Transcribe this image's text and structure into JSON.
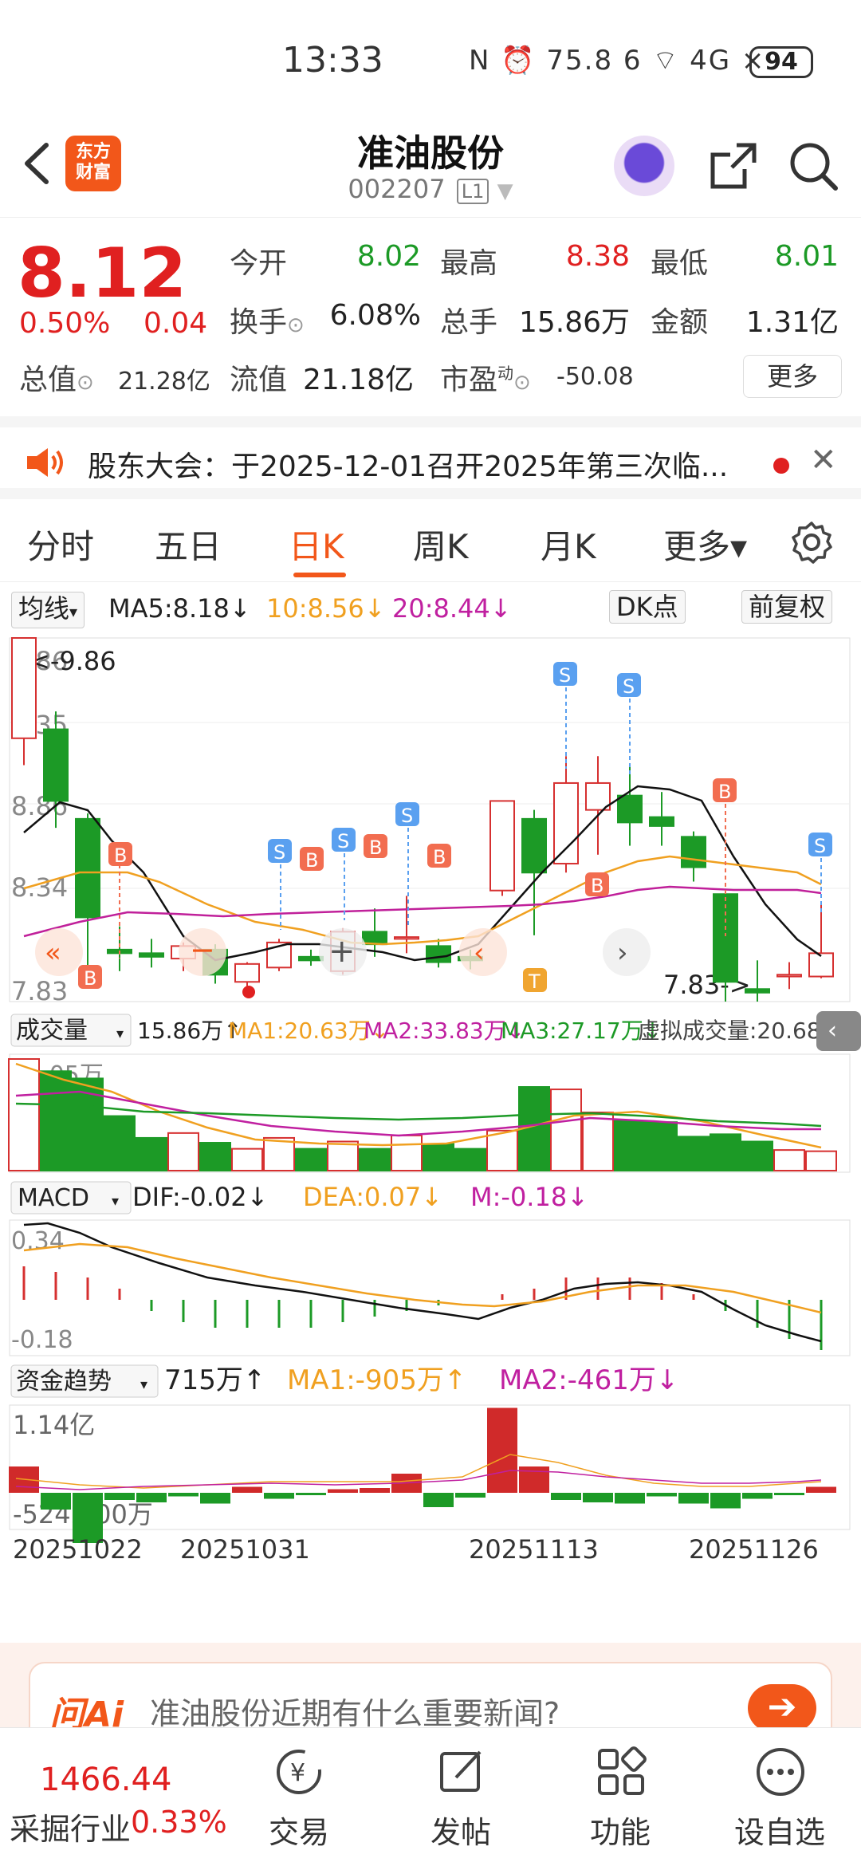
{
  "status": {
    "time": "13:33",
    "speed": "75.8 K/s",
    "battery": "94",
    "icons": "N ⏰ 75.8 6 ⌔ 4G ×"
  },
  "header": {
    "brand": "东方财富",
    "brand_line1": "东方",
    "brand_line2": "财富",
    "stock_name": "准油股份",
    "stock_code": "002207",
    "level": "L1"
  },
  "quote": {
    "price": "8.12",
    "change_pct": "0.50%",
    "change_amt": "0.04",
    "open_label": "今开",
    "open": "8.02",
    "high_label": "最高",
    "high": "8.38",
    "low_label": "最低",
    "low": "8.01",
    "turnover_label": "换手",
    "turnover": "6.08%",
    "volume_label": "总手",
    "volume": "15.86万",
    "amount_label": "金额",
    "amount": "1.31亿",
    "mktcap_label": "总值",
    "mktcap": "21.28亿",
    "float_label": "流值",
    "float": "21.18亿",
    "pe_label": "市盈",
    "pe_sup": "动",
    "pe": "-50.08",
    "more": "更多"
  },
  "notice": {
    "text": "股东大会：于2025-12-01召开2025年第三次临...",
    "close": "✕"
  },
  "tabs": [
    {
      "label": "分时"
    },
    {
      "label": "五日"
    },
    {
      "label": "日K"
    },
    {
      "label": "周K"
    },
    {
      "label": "月K"
    },
    {
      "label": "更多▾"
    }
  ],
  "kline_header": {
    "ma_select": "均线",
    "ma5": "MA5:8.18↓",
    "ma10": "10:8.56↓",
    "ma20": "20:8.44↓",
    "dk": "DK点",
    "adjust": "前复权"
  },
  "kline_axis": {
    "top": "9.86",
    "mid1": "9.35",
    "mid2": "8.86",
    "mid3": "8.34",
    "bottom": "7.83",
    "max_mark": "<-9.86",
    "min_mark": "7.83->"
  },
  "volume_header": {
    "select": "成交量",
    "vol": "15.86万↑",
    "ma1": "MA1:20.63万↓",
    "ma2": "MA2:33.83万↓",
    "ma3": "MA3:27.17万↓",
    "virtual": "虚拟成交量:20.68万",
    "axis_top": "92.05万"
  },
  "macd_header": {
    "select": "MACD",
    "dif": "DIF:-0.02↓",
    "dea": "DEA:0.07↓",
    "m": "M:-0.18↓",
    "axis_top": "0.34",
    "axis_bottom": "-0.18"
  },
  "fund_header": {
    "select": "资金趋势",
    "val": "715万↑",
    "ma1": "MA1:-905万↑",
    "ma2": "MA2:-461万↓",
    "axis_top": "1.14亿",
    "axis_bottom": "-5242.00万"
  },
  "dates": [
    "20251022",
    "20251031",
    "20251113",
    "20251126"
  ],
  "signals": {
    "b": "B",
    "s": "S",
    "t": "T"
  },
  "chart_data": {
    "type": "candlestick",
    "dates_shown": [
      "20251022",
      "20251031",
      "20251113",
      "20251126"
    ],
    "y_range": [
      7.83,
      9.86
    ],
    "candles": [
      {
        "o": 9.3,
        "c": 9.86,
        "h": 9.86,
        "l": 9.15
      },
      {
        "o": 9.35,
        "c": 8.95,
        "h": 9.45,
        "l": 8.8
      },
      {
        "o": 8.85,
        "c": 8.3,
        "h": 8.88,
        "l": 8.02
      },
      {
        "o": 8.12,
        "c": 8.1,
        "h": 8.25,
        "l": 8.0
      },
      {
        "o": 8.1,
        "c": 8.08,
        "h": 8.18,
        "l": 8.02
      },
      {
        "o": 8.07,
        "c": 8.14,
        "h": 8.16,
        "l": 8.0
      },
      {
        "o": 8.12,
        "c": 7.98,
        "h": 8.15,
        "l": 7.93
      },
      {
        "o": 7.94,
        "c": 8.04,
        "h": 8.05,
        "l": 7.9
      },
      {
        "o": 8.02,
        "c": 8.16,
        "h": 8.18,
        "l": 8.0
      },
      {
        "o": 8.08,
        "c": 8.06,
        "h": 8.12,
        "l": 8.03
      },
      {
        "o": 8.0,
        "c": 8.22,
        "h": 8.24,
        "l": 7.98
      },
      {
        "o": 8.22,
        "c": 8.15,
        "h": 8.35,
        "l": 8.08
      },
      {
        "o": 8.18,
        "c": 8.19,
        "h": 8.42,
        "l": 8.1
      },
      {
        "o": 8.14,
        "c": 8.05,
        "h": 8.18,
        "l": 8.02
      },
      {
        "o": 8.08,
        "c": 8.06,
        "h": 8.12,
        "l": 8.01
      },
      {
        "o": 8.45,
        "c": 8.95,
        "h": 8.95,
        "l": 8.42
      },
      {
        "o": 8.85,
        "c": 8.55,
        "h": 8.9,
        "l": 8.2
      },
      {
        "o": 8.6,
        "c": 9.05,
        "h": 9.2,
        "l": 8.55
      },
      {
        "o": 8.9,
        "c": 9.05,
        "h": 9.2,
        "l": 8.65
      },
      {
        "o": 8.98,
        "c": 8.83,
        "h": 9.15,
        "l": 8.7
      },
      {
        "o": 8.86,
        "c": 8.81,
        "h": 9.0,
        "l": 8.7
      },
      {
        "o": 8.75,
        "c": 8.58,
        "h": 8.78,
        "l": 8.5
      },
      {
        "o": 8.43,
        "c": 7.94,
        "h": 8.43,
        "l": 7.83
      },
      {
        "o": 7.9,
        "c": 7.88,
        "h": 8.06,
        "l": 7.83
      },
      {
        "o": 7.97,
        "c": 7.98,
        "h": 8.05,
        "l": 7.9
      },
      {
        "o": 7.97,
        "c": 8.1,
        "h": 8.38,
        "l": 7.96
      }
    ],
    "volume_max": 92.05,
    "volumes": [
      92.05,
      82,
      76,
      45,
      27,
      31,
      23,
      18,
      27,
      18,
      24,
      18,
      29,
      22,
      18,
      33,
      69,
      67,
      48,
      41,
      40,
      28,
      30,
      24,
      17,
      16
    ],
    "fund_flow": [
      2.2,
      -1.4,
      -4.2,
      -0.6,
      -0.8,
      -0.3,
      -0.9,
      0.5,
      -0.5,
      -0.2,
      0.3,
      0.4,
      1.6,
      -1.2,
      -0.4,
      7.1,
      2.2,
      -0.6,
      -0.8,
      -0.9,
      -0.3,
      -0.9,
      -1.3,
      -0.5,
      -0.2,
      0.5
    ]
  },
  "ai_bar": {
    "logo": "问Ai",
    "prompt": "准油股份近期有什么重要新闻?",
    "go": "➔"
  },
  "bottom_nav": {
    "index_value": "1466.44",
    "index_name": "采掘行业",
    "index_pct": "0.33%",
    "trade": "交易",
    "post": "发帖",
    "func": "功能",
    "watch": "设自选"
  }
}
